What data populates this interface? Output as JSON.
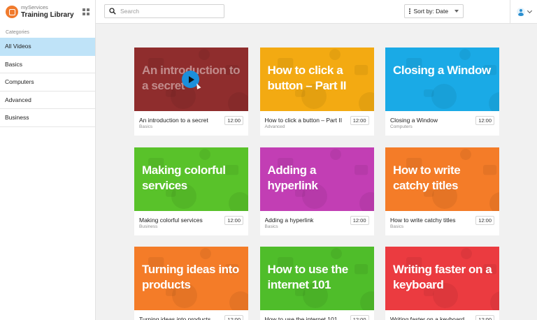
{
  "app": {
    "name": "myServices",
    "title": "Training Library",
    "logo_color": "#f07a2c"
  },
  "sidebar": {
    "heading": "Categories",
    "items": [
      {
        "label": "All Videos",
        "active": true
      },
      {
        "label": "Basics"
      },
      {
        "label": "Computers"
      },
      {
        "label": "Advanced"
      },
      {
        "label": "Business"
      }
    ],
    "active_color": "#bfe3f8"
  },
  "topbar": {
    "search_placeholder": "Search",
    "sort_label": "Sort by: Date"
  },
  "accent": "#1c8fdb",
  "videos": [
    {
      "thumb_text": "An introduction to a secret",
      "title": "An introduction to a secret",
      "category": "Basics",
      "duration": "12:00",
      "color": "#8f2d2d",
      "playing": true
    },
    {
      "thumb_text": "How to click a button – Part II",
      "title": "How to click a button – Part II",
      "category": "Advanced",
      "duration": "12:00",
      "color": "#f3aa12"
    },
    {
      "thumb_text": "Closing a Window",
      "title": "Closing a Window",
      "category": "Computers",
      "duration": "12:00",
      "color": "#1aaae6"
    },
    {
      "thumb_text": "Making colorful services",
      "title": "Making colorful services",
      "category": "Business",
      "duration": "12:00",
      "color": "#59c22a"
    },
    {
      "thumb_text": "Adding a hyperlink",
      "title": "Adding a hyperlink",
      "category": "Basics",
      "duration": "12:00",
      "color": "#c23eb4"
    },
    {
      "thumb_text": "How to write catchy titles",
      "title": "How to write catchy titles",
      "category": "Basics",
      "duration": "12:00",
      "color": "#f47c28"
    },
    {
      "thumb_text": "Turning ideas into products",
      "title": "Turning ideas into products",
      "category": "",
      "duration": "12:00",
      "color": "#f47c28"
    },
    {
      "thumb_text": "How to use the internet 101",
      "title": "How to use the internet 101",
      "category": "",
      "duration": "12:00",
      "color": "#4fbd2a"
    },
    {
      "thumb_text": "Writing faster on a keyboard",
      "title": "Writing faster on a keyboard",
      "category": "",
      "duration": "12:00",
      "color": "#eb3b40"
    }
  ]
}
